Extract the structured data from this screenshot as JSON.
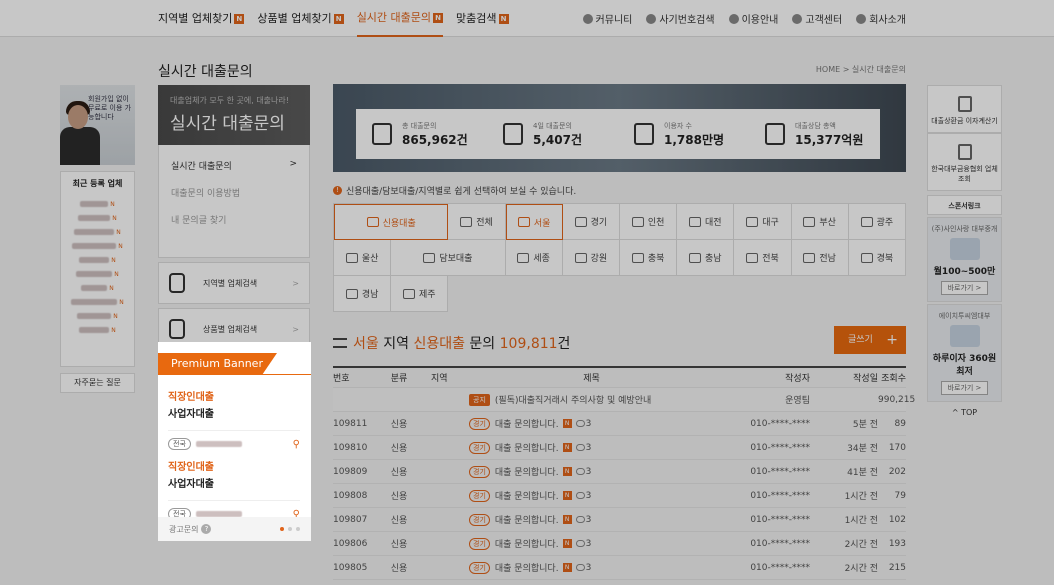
{
  "nav": {
    "menu": [
      {
        "label": "지역별 업체찾기",
        "badge": "N",
        "active": false
      },
      {
        "label": "상품별 업체찾기",
        "badge": "N",
        "active": false
      },
      {
        "label": "실시간 대출문의",
        "badge": "N",
        "active": true
      },
      {
        "label": "맞춤검색",
        "badge": "N",
        "active": false
      }
    ],
    "util": [
      "커뮤니티",
      "사기번호검색",
      "이용안내",
      "고객센터",
      "회사소개"
    ]
  },
  "page": {
    "title": "실시간 대출문의",
    "breadcrumb": "HOME > 실시간 대출문의"
  },
  "left": {
    "ad_text": "회원가입 없이 무료로 이용 가능합니다",
    "recent_title": "최근 등록 업체",
    "recent_badge": "N",
    "faq": "자주묻는 질문"
  },
  "lnb": {
    "subtitle": "대출업체가 모두 한 곳에, 대출나라!",
    "title": "실시간 대출문의",
    "items": [
      {
        "label": "실시간 대출문의",
        "arrow": ">"
      },
      {
        "label": "대출문의 이용방법",
        "arrow": ""
      },
      {
        "label": "내 문의글 찾기",
        "arrow": ""
      }
    ],
    "boxes": [
      {
        "label": "지역별 업체검색",
        "arrow": ">"
      },
      {
        "label": "상품별 업체검색",
        "arrow": ">"
      }
    ]
  },
  "premium": {
    "tag": "Premium Banner",
    "cards": [
      {
        "line1": "직장인대출",
        "line2": "사업자대출",
        "pill": "전국"
      },
      {
        "line1": "직장인대출",
        "line2": "사업자대출",
        "pill": "전국"
      }
    ],
    "footer": "광고문의",
    "help": "?"
  },
  "stats": [
    {
      "label": "총 대출문의",
      "value": "865,962건",
      "icon": "document-check-icon"
    },
    {
      "label": "4일 대출문의",
      "value": "5,407건",
      "icon": "bar-chart-icon"
    },
    {
      "label": "이용자 수",
      "value": "1,788만명",
      "icon": "users-icon"
    },
    {
      "label": "대출상담 총액",
      "value": "15,377억원",
      "icon": "money-stack-icon"
    }
  ],
  "notice": "신용대출/담보대출/지역별로 쉽게 선택하여 보실 수 있습니다.",
  "regions": [
    {
      "label": "신용대출",
      "selected": true,
      "wide": true
    },
    {
      "label": "전체",
      "selected": false
    },
    {
      "label": "서울",
      "selected": true
    },
    {
      "label": "경기",
      "selected": false
    },
    {
      "label": "인천",
      "selected": false
    },
    {
      "label": "대전",
      "selected": false
    },
    {
      "label": "대구",
      "selected": false
    },
    {
      "label": "부산",
      "selected": false
    },
    {
      "label": "광주",
      "selected": false
    },
    {
      "label": "울산",
      "selected": false
    },
    {
      "label": "담보대출",
      "selected": false,
      "wide": true
    },
    {
      "label": "세종",
      "selected": false
    },
    {
      "label": "강원",
      "selected": false
    },
    {
      "label": "충북",
      "selected": false
    },
    {
      "label": "충남",
      "selected": false
    },
    {
      "label": "전북",
      "selected": false
    },
    {
      "label": "전남",
      "selected": false
    },
    {
      "label": "경북",
      "selected": false
    },
    {
      "label": "경남",
      "selected": false
    },
    {
      "label": "제주",
      "selected": false
    }
  ],
  "list": {
    "region": "서울",
    "region_suffix": " 지역 ",
    "type": "신용대출",
    "type_suffix": " 문의 ",
    "count": "109,811",
    "count_suffix": "건",
    "write_label": "글쓰기",
    "write_plus": "+"
  },
  "table": {
    "headers": {
      "no": "번호",
      "cat": "분류",
      "reg": "지역",
      "title": "제목",
      "author": "작성자",
      "date": "작성일",
      "views": "조회수"
    },
    "notice_row": {
      "tag": "공지",
      "title": "(필독)대출직거래시 주의사항 및 예방안내",
      "author": "운영팀",
      "views": "990,215"
    },
    "rows": [
      {
        "no": "109811",
        "cat": "신용",
        "reg": "경기",
        "title": "대출 문의합니다.",
        "n": "N",
        "comments": "3",
        "author": "010-****-****",
        "date": "5분 전",
        "views": "89"
      },
      {
        "no": "109810",
        "cat": "신용",
        "reg": "경기",
        "title": "대출 문의합니다.",
        "n": "N",
        "comments": "3",
        "author": "010-****-****",
        "date": "34분 전",
        "views": "170"
      },
      {
        "no": "109809",
        "cat": "신용",
        "reg": "경기",
        "title": "대출 문의합니다.",
        "n": "N",
        "comments": "3",
        "author": "010-****-****",
        "date": "41분 전",
        "views": "202"
      },
      {
        "no": "109808",
        "cat": "신용",
        "reg": "경기",
        "title": "대출 문의합니다.",
        "n": "N",
        "comments": "3",
        "author": "010-****-****",
        "date": "1시간 전",
        "views": "79"
      },
      {
        "no": "109807",
        "cat": "신용",
        "reg": "경기",
        "title": "대출 문의합니다.",
        "n": "N",
        "comments": "3",
        "author": "010-****-****",
        "date": "1시간 전",
        "views": "102"
      },
      {
        "no": "109806",
        "cat": "신용",
        "reg": "경기",
        "title": "대출 문의합니다.",
        "n": "N",
        "comments": "3",
        "author": "010-****-****",
        "date": "2시간 전",
        "views": "193"
      },
      {
        "no": "109805",
        "cat": "신용",
        "reg": "경기",
        "title": "대출 문의합니다.",
        "n": "N",
        "comments": "3",
        "author": "010-****-****",
        "date": "2시간 전",
        "views": "215"
      }
    ]
  },
  "right": {
    "calc": "대출상환금 이자계산기",
    "assoc": "한국대부금융협회 업체조회",
    "sponsor": "스폰서링크",
    "ad1": {
      "name": "(주)사인사랑 대부중개",
      "big": "월100~500만",
      "more": "바로가기 >"
    },
    "ad2": {
      "name": "에이치투씨엠대부",
      "big": "하루이자 360원최저",
      "more": "바로가기 >"
    },
    "top": "TOP"
  },
  "colors": {
    "accent": "#e0641a",
    "dark": "#4a4a4a"
  }
}
